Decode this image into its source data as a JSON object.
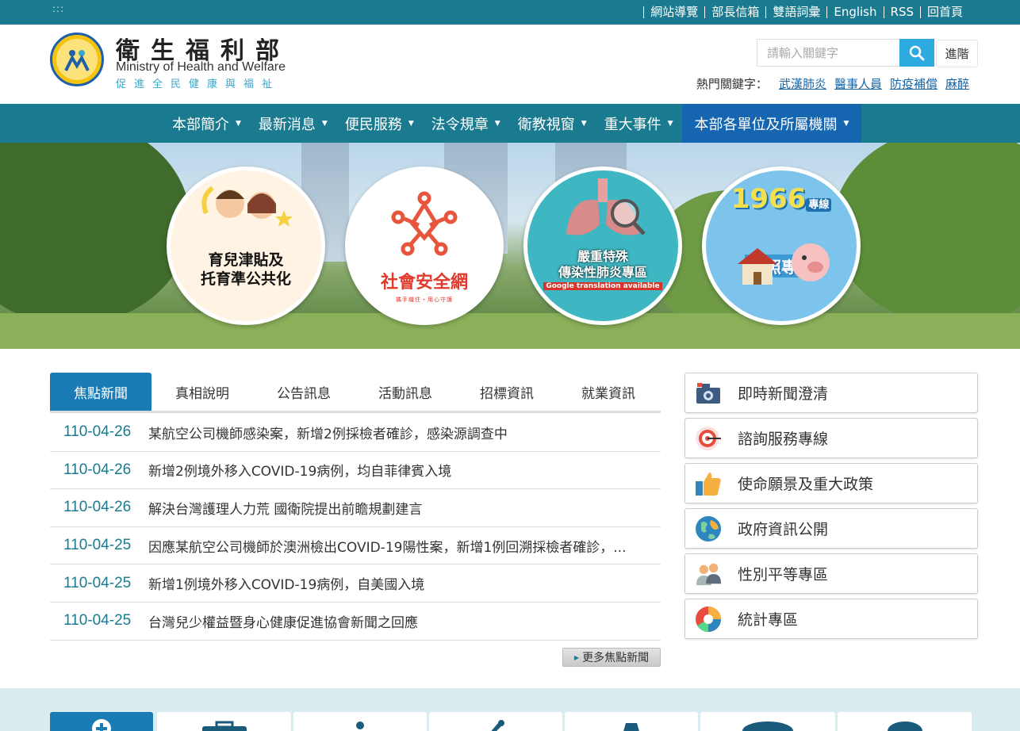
{
  "topbar": {
    "accesskey": ":::",
    "links": [
      "網站導覽",
      "部長信箱",
      "雙語詞彙",
      "English",
      "RSS",
      "回首頁"
    ]
  },
  "header": {
    "title_zh": "衛生福利部",
    "title_en": "Ministry of Health and Welfare",
    "slogan": "促進全民健康與福祉",
    "search_placeholder": "請輸入關鍵字",
    "advanced_label": "進階",
    "hotkeys_label": "熱門關鍵字：",
    "hotkeys": [
      "武漢肺炎",
      "醫事人員",
      "防疫補償",
      "麻醉"
    ]
  },
  "nav": {
    "items": [
      "本部簡介",
      "最新消息",
      "便民服務",
      "法令規章",
      "衛教視窗",
      "重大事件",
      "本部各單位及所屬機關"
    ],
    "active_index": 6
  },
  "banner": {
    "items": [
      {
        "title_line1": "育兒津貼及",
        "title_line2": "托育準公共化"
      },
      {
        "title": "社會安全網",
        "subtitle": "攜手織住・用心守護"
      },
      {
        "title_line1": "嚴重特殊",
        "title_line2": "傳染性肺炎專區",
        "badge": "Google translation available"
      },
      {
        "number": "1966",
        "number_suffix": "專線",
        "title": "長照專區"
      }
    ]
  },
  "tabs": {
    "items": [
      "焦點新聞",
      "真相說明",
      "公告訊息",
      "活動訊息",
      "招標資訊",
      "就業資訊"
    ],
    "active_index": 0
  },
  "news": [
    {
      "date": "110-04-26",
      "title": "某航空公司機師感染案，新增2例採檢者確診，感染源調查中"
    },
    {
      "date": "110-04-26",
      "title": "新增2例境外移入COVID-19病例，均自菲律賓入境"
    },
    {
      "date": "110-04-26",
      "title": "解決台灣護理人力荒 國衛院提出前瞻規劃建言"
    },
    {
      "date": "110-04-25",
      "title": "因應某航空公司機師於澳洲檢出COVID-19陽性案，新增1例回溯採檢者確診，..."
    },
    {
      "date": "110-04-25",
      "title": "新增1例境外移入COVID-19病例，自美國入境"
    },
    {
      "date": "110-04-25",
      "title": "台灣兒少權益暨身心健康促進協會新聞之回應"
    }
  ],
  "more_news_label": "更多焦點新聞",
  "side": [
    {
      "label": "即時新聞澄清",
      "icon": "camera-icon"
    },
    {
      "label": "諮詢服務專線",
      "icon": "target-icon"
    },
    {
      "label": "使命願景及重大政策",
      "icon": "thumbs-up-icon"
    },
    {
      "label": "政府資訊公開",
      "icon": "globe-icon"
    },
    {
      "label": "性別平等專區",
      "icon": "people-icon"
    },
    {
      "label": "統計專區",
      "icon": "pie-chart-icon"
    }
  ],
  "colors": {
    "brand_teal": "#1a7a8f",
    "active_blue": "#1a7bb5",
    "search_blue": "#2daadf",
    "link_blue": "#1565a8"
  }
}
